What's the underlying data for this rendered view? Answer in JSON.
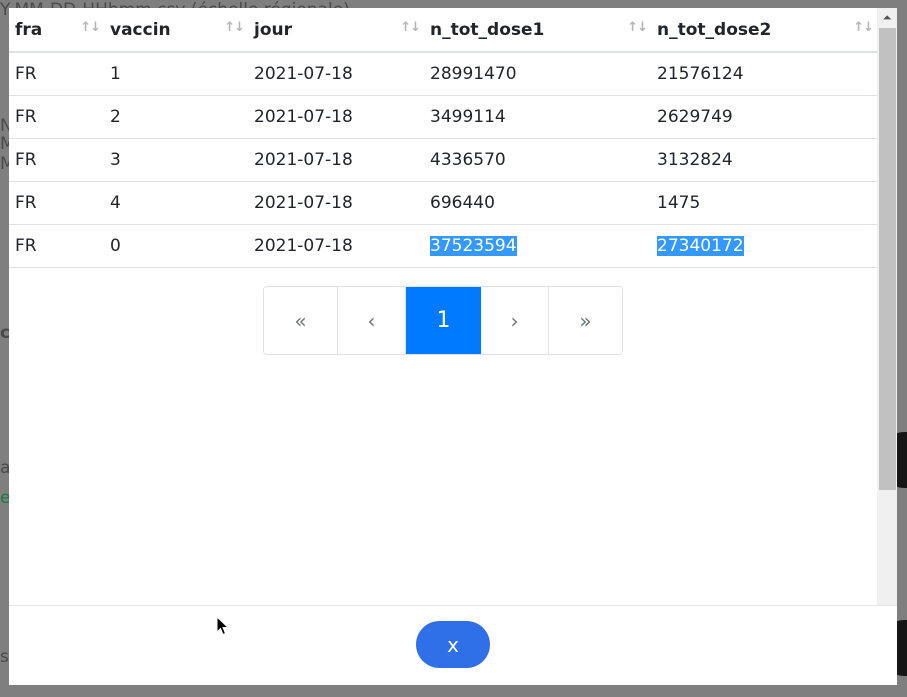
{
  "backdrop": {
    "ghost_lines": [
      "Y-MM-DD-HHhmm.csv (échelle régionale)",
      "N",
      "M",
      "M",
      "c",
      "a",
      "e",
      "s"
    ]
  },
  "table": {
    "columns": [
      "fra",
      "vaccin",
      "jour",
      "n_tot_dose1",
      "n_tot_dose2"
    ],
    "rows": [
      [
        "FR",
        "1",
        "2021-07-18",
        "28991470",
        "21576124"
      ],
      [
        "FR",
        "2",
        "2021-07-18",
        "3499114",
        "2629749"
      ],
      [
        "FR",
        "3",
        "2021-07-18",
        "4336570",
        "3132824"
      ],
      [
        "FR",
        "4",
        "2021-07-18",
        "696440",
        "1475"
      ],
      [
        "FR",
        "0",
        "2021-07-18",
        "37523594",
        "27340172"
      ]
    ],
    "sort_icon": "↑↓"
  },
  "pagination": {
    "first": "«",
    "prev": "‹",
    "current": "1",
    "next": "›",
    "last": "»"
  },
  "footer": {
    "close_label": "x"
  },
  "icons": {
    "scroll_up": "⏶"
  },
  "colors": {
    "accent": "#007bff",
    "close_button": "#2f6fe8",
    "selection": "#3399ff"
  }
}
